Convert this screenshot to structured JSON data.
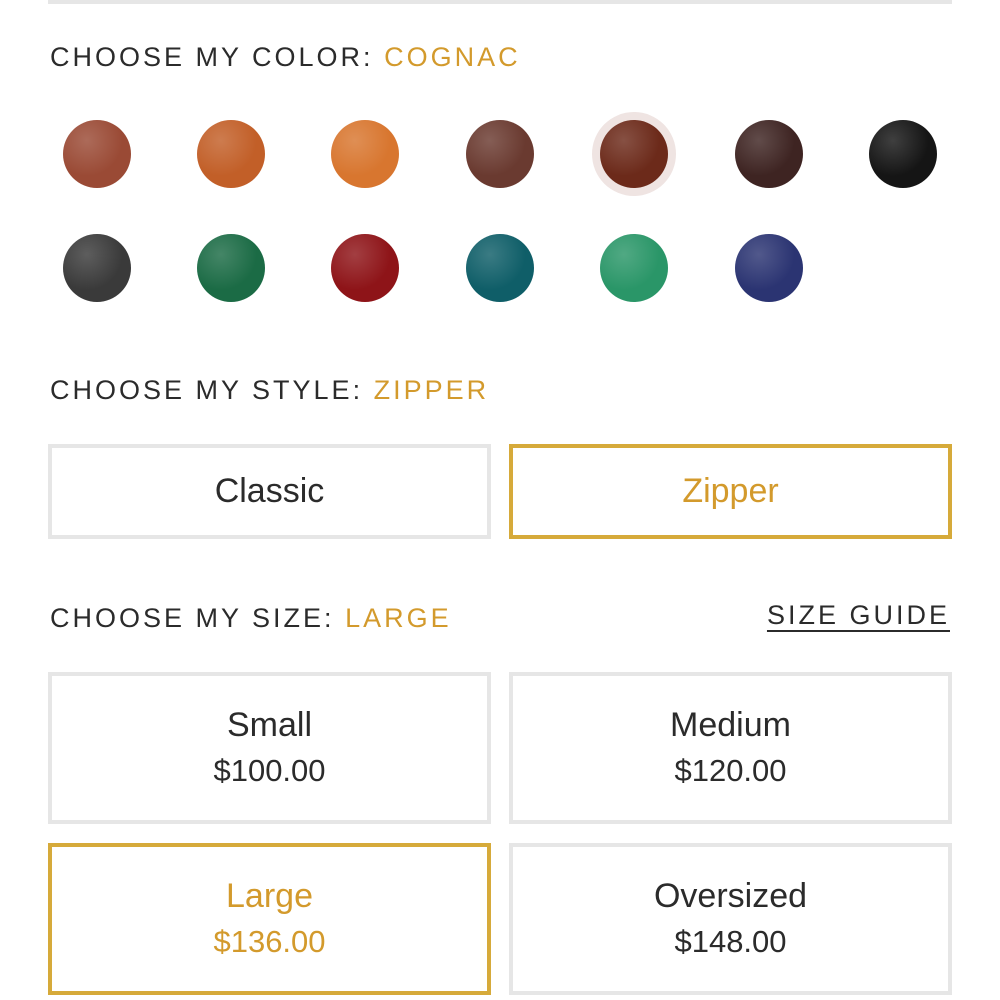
{
  "color_section": {
    "heading": "CHOOSE MY COLOR:",
    "selected": "COGNAC",
    "swatches": [
      {
        "name": "brown-pebbled",
        "color": "#9a4a35"
      },
      {
        "name": "tan-orange",
        "color": "#c25f28"
      },
      {
        "name": "floral-embossed-orange",
        "color": "#d8762f"
      },
      {
        "name": "dark-brown-pebbled",
        "color": "#6a3a30"
      },
      {
        "name": "cognac",
        "color": "#6c2a1a"
      },
      {
        "name": "espresso",
        "color": "#3e2422"
      },
      {
        "name": "black",
        "color": "#151515"
      },
      {
        "name": "black-pebbled",
        "color": "#3a3a3a"
      },
      {
        "name": "green",
        "color": "#1b6b45"
      },
      {
        "name": "red",
        "color": "#8e1418"
      },
      {
        "name": "teal-pebbled",
        "color": "#0f5e68"
      },
      {
        "name": "jade",
        "color": "#2a9668"
      },
      {
        "name": "navy",
        "color": "#2b3472"
      }
    ]
  },
  "style_section": {
    "heading": "CHOOSE MY STYLE:",
    "selected": "ZIPPER",
    "options": [
      "Classic",
      "Zipper"
    ]
  },
  "size_section": {
    "heading": "CHOOSE MY SIZE:",
    "selected": "LARGE",
    "size_guide": "SIZE GUIDE",
    "options": [
      {
        "name": "Small",
        "price": "$100.00"
      },
      {
        "name": "Medium",
        "price": "$120.00"
      },
      {
        "name": "Large",
        "price": "$136.00"
      },
      {
        "name": "Oversized",
        "price": "$148.00"
      }
    ]
  },
  "colors": {
    "accent": "#d39a2c",
    "border": "#e6e6e6",
    "text": "#2b2b2b"
  }
}
